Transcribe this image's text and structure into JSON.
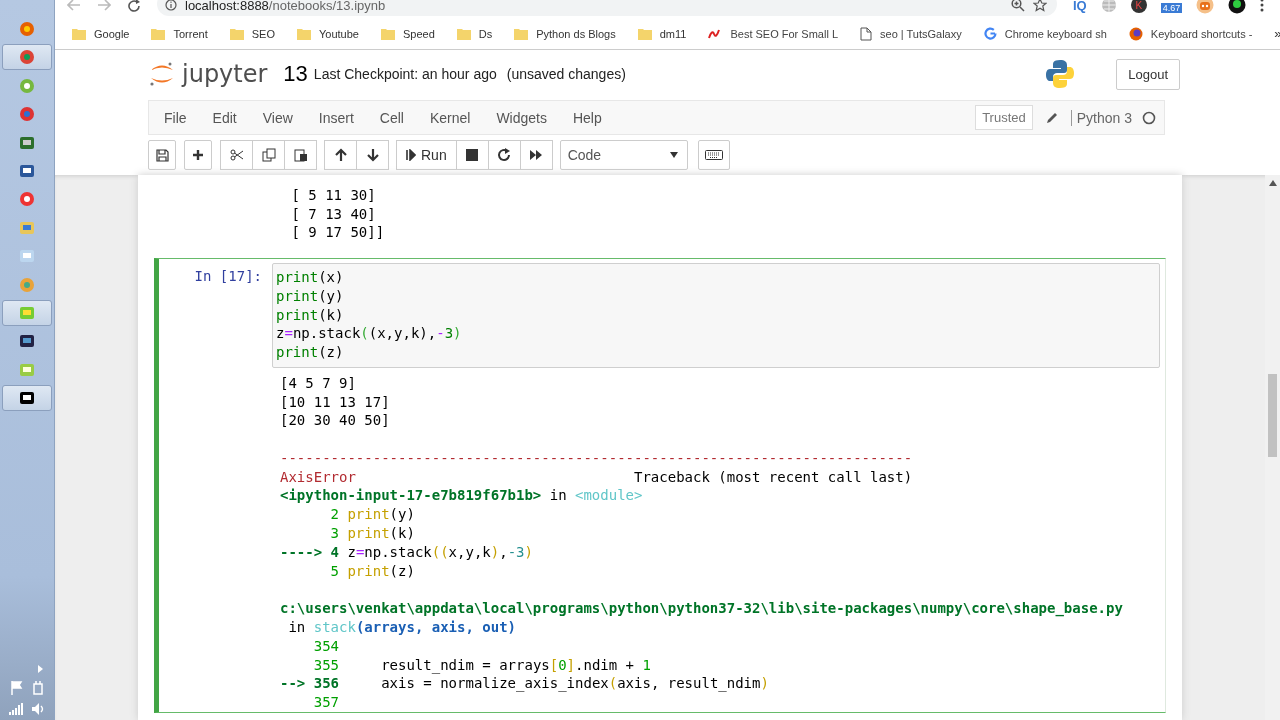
{
  "taskbar": {
    "apps": [
      {
        "selected": false
      },
      {
        "selected": true
      },
      {
        "selected": false
      },
      {
        "selected": false
      },
      {
        "selected": false
      },
      {
        "selected": false
      },
      {
        "selected": false
      },
      {
        "selected": false
      },
      {
        "selected": false
      },
      {
        "selected": false
      },
      {
        "selected": true
      },
      {
        "selected": false
      },
      {
        "selected": false
      },
      {
        "selected": true
      }
    ]
  },
  "browser": {
    "url_host": "localhost:8888",
    "url_path": "/notebooks/13.ipynb",
    "extensions": [
      {
        "kind": "text",
        "label": "IQ"
      },
      {
        "kind": "globe"
      },
      {
        "kind": "letter",
        "label": "K"
      },
      {
        "kind": "badge",
        "label": "4.67"
      },
      {
        "kind": "bot"
      },
      {
        "kind": "dot"
      }
    ],
    "bookmarks": [
      {
        "kind": "folder",
        "label": "Google"
      },
      {
        "kind": "folder",
        "label": "Torrent"
      },
      {
        "kind": "folder",
        "label": "SEO"
      },
      {
        "kind": "folder",
        "label": "Youtube"
      },
      {
        "kind": "folder",
        "label": "Speed"
      },
      {
        "kind": "folder",
        "label": "Ds"
      },
      {
        "kind": "folder",
        "label": "Python ds Blogs"
      },
      {
        "kind": "folder",
        "label": "dm11"
      },
      {
        "kind": "site",
        "label": "Best SEO For Small L"
      },
      {
        "kind": "page",
        "label": "seo | TutsGalaxy"
      },
      {
        "kind": "google",
        "label": "Chrome keyboard sh"
      },
      {
        "kind": "firefox",
        "label": "Keyboard shortcuts -"
      }
    ],
    "more": "»"
  },
  "header": {
    "logo": "jupyter",
    "notebook": "13",
    "checkpoint": "Last Checkpoint: an hour ago",
    "status": "(unsaved changes)",
    "logout": "Logout"
  },
  "menu": {
    "items": [
      "File",
      "Edit",
      "View",
      "Insert",
      "Cell",
      "Kernel",
      "Widgets",
      "Help"
    ],
    "trusted": "Trusted",
    "kernel": "Python 3",
    "kernel_busy": false
  },
  "toolbar": {
    "run": "Run",
    "cell_type": "Code"
  },
  "notebook": {
    "previous_output": [
      " [ 5 11 30]",
      " [ 7 13 40]",
      " [ 9 17 50]]"
    ],
    "cell": {
      "prompt": "In [17]:",
      "selected": true,
      "code": [
        [
          {
            "kind": "builtin",
            "text": "print"
          },
          {
            "kind": "plain",
            "text": "(x)"
          }
        ],
        [
          {
            "kind": "builtin",
            "text": "print"
          },
          {
            "kind": "plain",
            "text": "(y)"
          }
        ],
        [
          {
            "kind": "builtin",
            "text": "print"
          },
          {
            "kind": "plain",
            "text": "(k)"
          }
        ],
        [
          {
            "kind": "plain",
            "text": "z"
          },
          {
            "kind": "op",
            "text": "="
          },
          {
            "kind": "plain",
            "text": "np.stack"
          },
          {
            "kind": "bracket",
            "text": "("
          },
          {
            "kind": "plain",
            "text": "(x,y,k),"
          },
          {
            "kind": "op",
            "text": "-"
          },
          {
            "kind": "num",
            "text": "3"
          },
          {
            "kind": "bracket",
            "text": ")"
          }
        ],
        [
          {
            "kind": "builtin",
            "text": "print"
          },
          {
            "kind": "plain",
            "text": "(z)"
          }
        ]
      ],
      "stdout": [
        "[4 5 7 9]",
        "[10 11 13 17]",
        "[20 30 40 50]"
      ],
      "traceback": [
        [
          [
            {
              "kind": "err",
              "text": "---------------------------------------------------------------------------"
            }
          ],
          [
            {
              "kind": "err",
              "text": "AxisError"
            },
            {
              "kind": "plain",
              "text": "                                 Traceback (most recent call last)"
            }
          ],
          [
            {
              "kind": "greenb",
              "text": "<ipython-input-17-e7b819f67b1b>"
            },
            {
              "kind": "plain",
              "text": " in "
            },
            {
              "kind": "cyan",
              "text": "<module>"
            }
          ],
          [
            {
              "kind": "green",
              "text": "      2 "
            },
            {
              "kind": "yellow",
              "text": "print"
            },
            {
              "kind": "plain",
              "text": "(y)"
            }
          ],
          [
            {
              "kind": "green",
              "text": "      3 "
            },
            {
              "kind": "yellow",
              "text": "print"
            },
            {
              "kind": "plain",
              "text": "(k)"
            }
          ],
          [
            {
              "kind": "greenb",
              "text": "----> 4 "
            },
            {
              "kind": "plain",
              "text": "z"
            },
            {
              "kind": "op",
              "text": "="
            },
            {
              "kind": "plain",
              "text": "np.stack"
            },
            {
              "kind": "yellow",
              "text": "(("
            },
            {
              "kind": "plain",
              "text": "x,y,k"
            },
            {
              "kind": "yellow",
              "text": ")"
            },
            {
              "kind": "plain",
              "text": ","
            },
            {
              "kind": "teal",
              "text": "-3"
            },
            {
              "kind": "yellow",
              "text": ")"
            }
          ],
          [
            {
              "kind": "green",
              "text": "      5 "
            },
            {
              "kind": "yellow",
              "text": "print"
            },
            {
              "kind": "plain",
              "text": "(z)"
            }
          ]
        ],
        [
          [
            {
              "kind": "greenb",
              "text": "c:\\users\\venkat\\appdata\\local\\programs\\python\\python37-32\\lib\\site-packages\\numpy\\core\\shape_base.py"
            }
          ],
          [
            {
              "kind": "plain",
              "text": " in "
            },
            {
              "kind": "cyan",
              "text": "stack"
            },
            {
              "kind": "blueb",
              "text": "(arrays, axis, out)"
            }
          ],
          [
            {
              "kind": "green",
              "text": "    354"
            }
          ],
          [
            {
              "kind": "green",
              "text": "    355"
            },
            {
              "kind": "plain",
              "text": "     result_ndim = arrays"
            },
            {
              "kind": "yellow",
              "text": "["
            },
            {
              "kind": "green",
              "text": "0"
            },
            {
              "kind": "yellow",
              "text": "]"
            },
            {
              "kind": "plain",
              "text": ".ndim + "
            },
            {
              "kind": "green",
              "text": "1"
            }
          ],
          [
            {
              "kind": "greenb",
              "text": "--> 356"
            },
            {
              "kind": "plain",
              "text": "     axis = normalize_axis_index"
            },
            {
              "kind": "yellow",
              "text": "("
            },
            {
              "kind": "plain",
              "text": "axis, result_ndim"
            },
            {
              "kind": "yellow",
              "text": ")"
            }
          ],
          [
            {
              "kind": "green",
              "text": "    357"
            }
          ]
        ]
      ]
    }
  }
}
